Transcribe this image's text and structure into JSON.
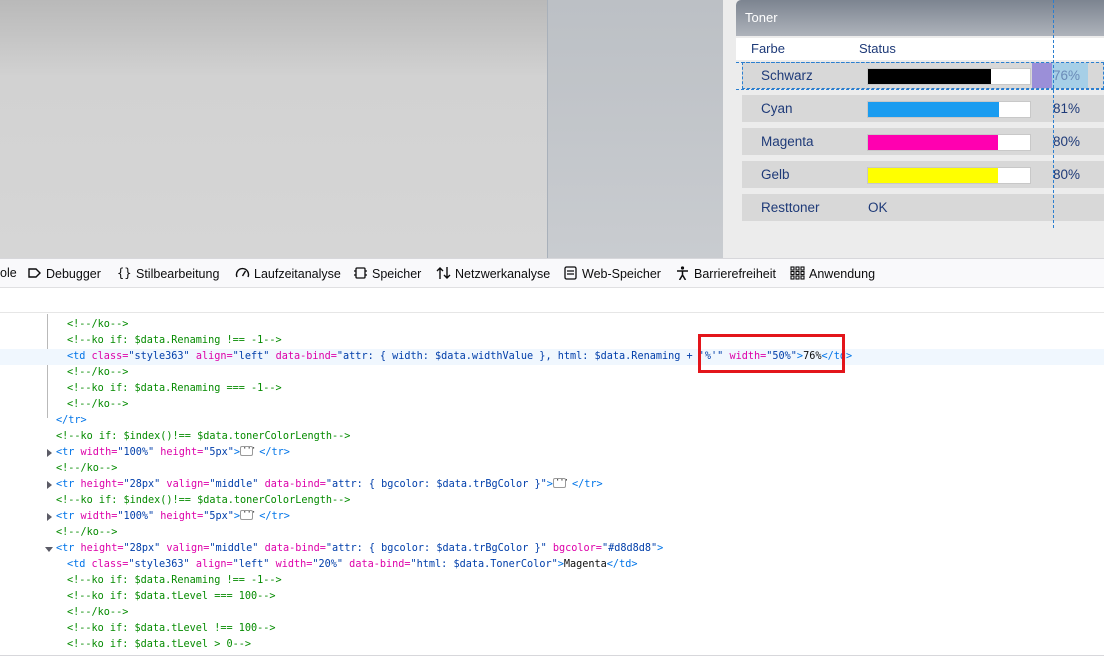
{
  "toner": {
    "title": "Toner",
    "columns": {
      "color": "Farbe",
      "status": "Status"
    },
    "rows": [
      {
        "label": "Schwarz",
        "level": 76,
        "percent": "76%",
        "color": "#000000"
      },
      {
        "label": "Cyan",
        "level": 81,
        "percent": "81%",
        "color": "#1a9cf0"
      },
      {
        "label": "Magenta",
        "level": 80,
        "percent": "80%",
        "color": "#ff00b0"
      },
      {
        "label": "Gelb",
        "level": 80,
        "percent": "80%",
        "color": "#ffff00"
      }
    ],
    "residual": {
      "label": "Resttoner",
      "status": "OK"
    }
  },
  "devtools": {
    "tabs": [
      {
        "label": "ole",
        "icon": "console-icon"
      },
      {
        "label": "Debugger",
        "icon": "debugger-icon"
      },
      {
        "label": "Stilbearbeitung",
        "icon": "style-editor-icon"
      },
      {
        "label": "Laufzeitanalyse",
        "icon": "performance-icon"
      },
      {
        "label": "Speicher",
        "icon": "memory-icon"
      },
      {
        "label": "Netzwerkanalyse",
        "icon": "network-icon"
      },
      {
        "label": "Web-Speicher",
        "icon": "storage-icon"
      },
      {
        "label": "Barrierefreiheit",
        "icon": "accessibility-icon"
      },
      {
        "label": "Anwendung",
        "icon": "application-icon"
      }
    ],
    "code": {
      "l0": "<!--/ko-->",
      "l1": "<!--ko if: $data.Renaming !== -1-->",
      "l2_open": "<td",
      "l2_a1": " class=",
      "l2_v1": "\"style363\"",
      "l2_a2": " align=",
      "l2_v2": "\"left\"",
      "l2_a3": " data-bind=",
      "l2_v3": "\"attr: { width: $data.widthValue }, html: $data.Renaming + '%'\"",
      "l2_a4": " width=",
      "l2_v4": "\"50%\"",
      "l2_close": ">",
      "l2_text": "76%",
      "l2_end": "</td>",
      "l3": "<!--/ko-->",
      "l4": "<!--ko if: $data.Renaming === -1-->",
      "l5": "<!--/ko-->",
      "l6": "</tr>",
      "l7": "<!--ko if: $index()!== $data.tonerColorLength-->",
      "l8_open": "<tr",
      "l8_a1": " width=",
      "l8_v1": "\"100%\"",
      "l8_a2": " height=",
      "l8_v2": "\"5px\"",
      "l8_close": ">",
      "l8_end": "</tr>",
      "l9": "<!--/ko-->",
      "l10_open": "<tr",
      "l10_a1": " height=",
      "l10_v1": "\"28px\"",
      "l10_a2": " valign=",
      "l10_v2": "\"middle\"",
      "l10_a3": " data-bind=",
      "l10_v3": "\"attr: { bgcolor: $data.trBgColor }\"",
      "l10_close": ">",
      "l10_end": "</tr>",
      "l11": "<!--ko if: $index()!== $data.tonerColorLength-->",
      "l12_open": "<tr",
      "l12_a1": " width=",
      "l12_v1": "\"100%\"",
      "l12_a2": " height=",
      "l12_v2": "\"5px\"",
      "l12_close": ">",
      "l12_end": "</tr>",
      "l13": "<!--/ko-->",
      "l14_open": "<tr",
      "l14_a1": " height=",
      "l14_v1": "\"28px\"",
      "l14_a2": " valign=",
      "l14_v2": "\"middle\"",
      "l14_a3": " data-bind=",
      "l14_v3": "\"attr: { bgcolor: $data.trBgColor }\"",
      "l14_a4": " bgcolor=",
      "l14_v4": "\"#d8d8d8\"",
      "l14_close": ">",
      "l15_open": "<td",
      "l15_a1": " class=",
      "l15_v1": "\"style363\"",
      "l15_a2": " align=",
      "l15_v2": "\"left\"",
      "l15_a3": " width=",
      "l15_v3": "\"20%\"",
      "l15_a4": " data-bind=",
      "l15_v4": "\"html: $data.TonerColor\"",
      "l15_close": ">",
      "l15_text": "Magenta",
      "l15_end": "</td>",
      "l16": "<!--ko if: $data.Renaming !== -1-->",
      "l17": "<!--ko if: $data.tLevel === 100-->",
      "l18": "<!--/ko-->",
      "l19": "<!--ko if: $data.tLevel !== 100-->",
      "l20": "<!--ko if: $data.tLevel > 0-->"
    }
  },
  "colors": {
    "annotation": "#e3151b",
    "guide": "#2b7fd0"
  }
}
